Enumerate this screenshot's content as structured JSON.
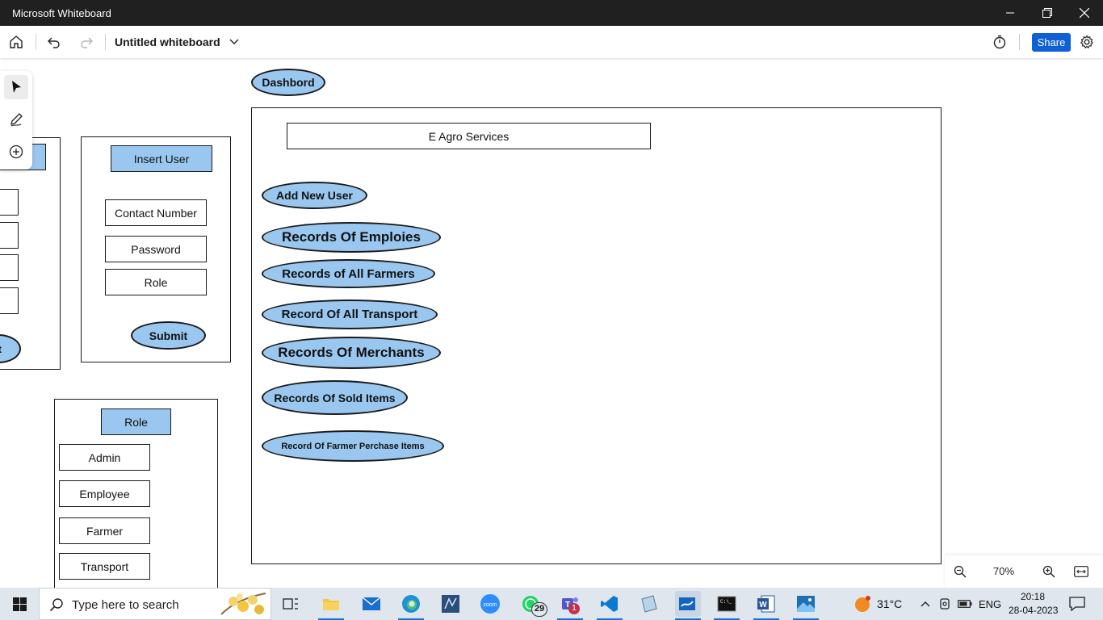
{
  "window": {
    "title": "Microsoft Whiteboard"
  },
  "toolbar": {
    "board_name": "Untitled whiteboard",
    "share_label": "Share"
  },
  "canvas": {
    "dashboard_label": "Dashbord",
    "app_title": "E Agro Services",
    "menu_buttons": [
      "Add New User",
      "Records Of Emploies",
      "Records of All Farmers",
      "Record Of All Transport",
      "Records Of Merchants",
      "Records Of Sold Items",
      "Record Of Farmer Perchase Items"
    ],
    "insert_user": {
      "header": "Insert User",
      "fields": [
        "Contact Number",
        "Password",
        "Role"
      ],
      "submit": "Submit"
    },
    "left_partial_button": "t",
    "role_panel": {
      "header": "Role",
      "options": [
        "Admin",
        "Employee",
        "Farmer",
        "Transport"
      ]
    }
  },
  "zoom": {
    "level": "70%"
  },
  "taskbar": {
    "search_placeholder": "Type here to search",
    "whatsapp_badge": "29",
    "teams_badge": "1",
    "weather": "31°C",
    "language": "ENG",
    "time": "20:18",
    "date": "28-04-2023"
  },
  "colors": {
    "shape_fill": "#9ac7ef",
    "share_button": "#0f5fd6",
    "titlebar": "#202020"
  }
}
